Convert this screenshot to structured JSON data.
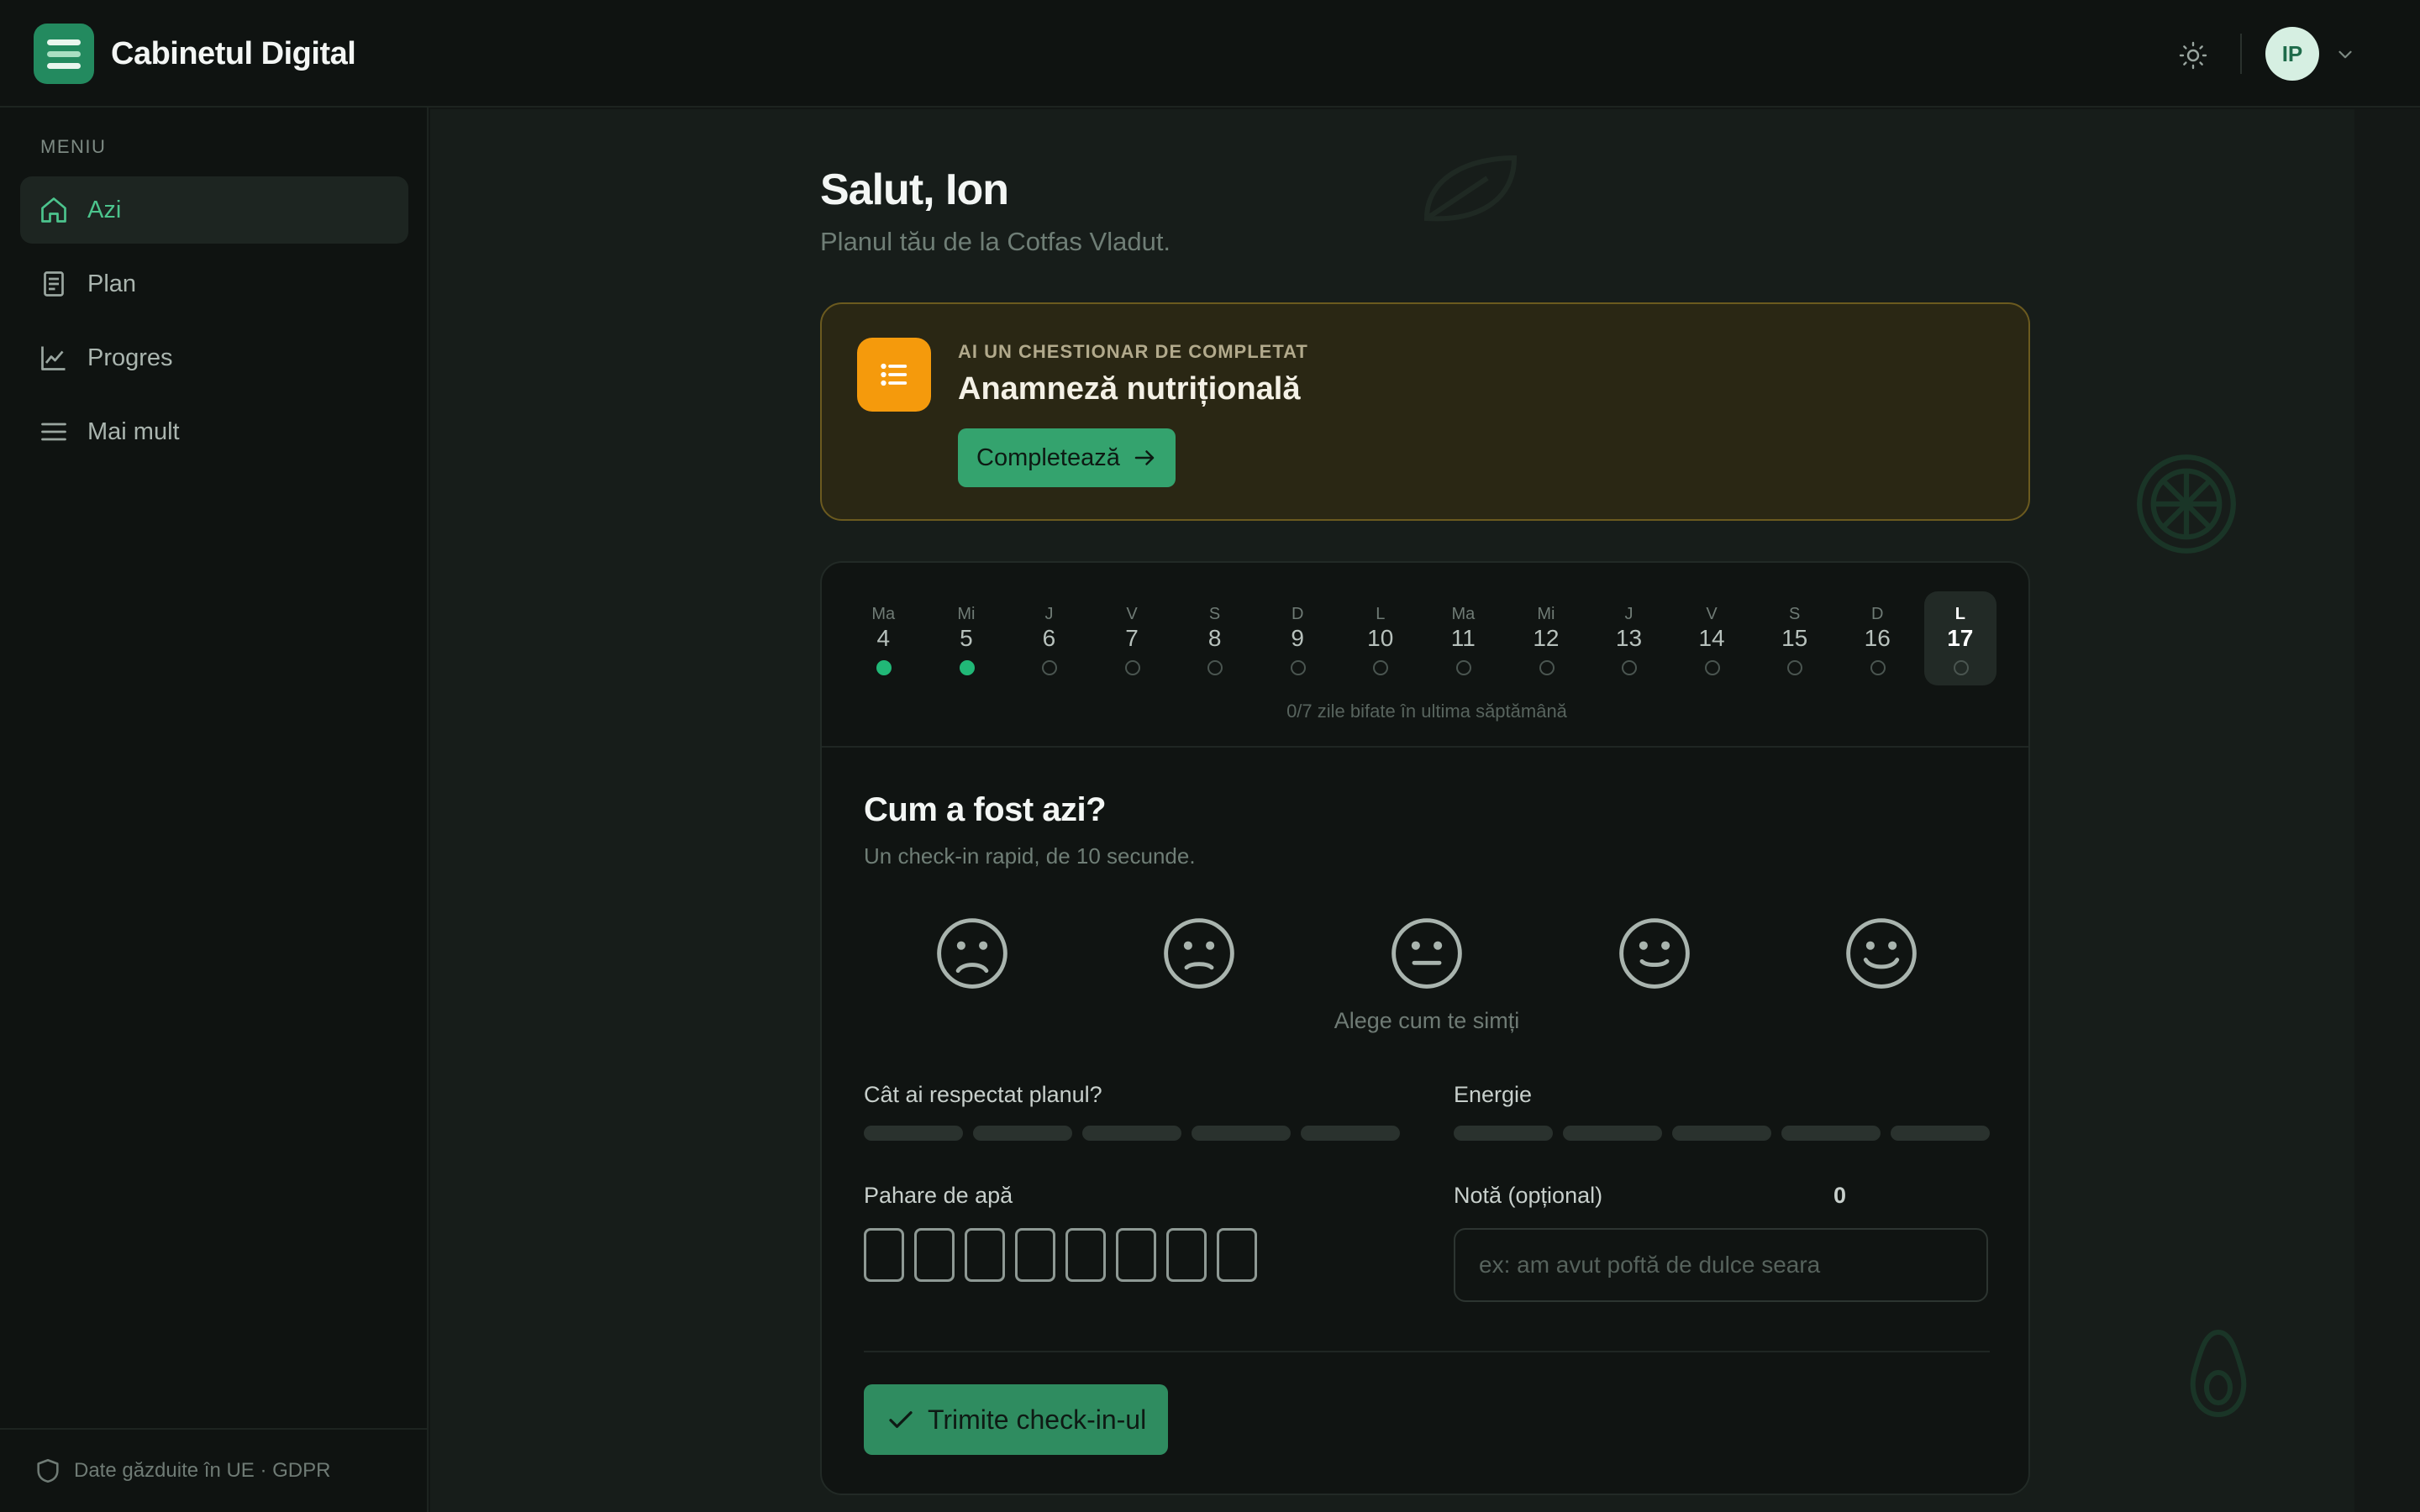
{
  "app": {
    "name": "Cabinetul Digital"
  },
  "header": {
    "avatar_initials": "IP"
  },
  "sidebar": {
    "heading": "MENIU",
    "items": [
      {
        "label": "Azi",
        "icon": "home-icon",
        "active": true
      },
      {
        "label": "Plan",
        "icon": "document-icon",
        "active": false
      },
      {
        "label": "Progres",
        "icon": "chart-icon",
        "active": false
      },
      {
        "label": "Mai mult",
        "icon": "menu-icon",
        "active": false
      }
    ],
    "footer": "Date găzduite în UE · GDPR"
  },
  "main": {
    "greeting": "Salut, Ion",
    "subtitle": "Planul tău de la Cotfas Vladut.",
    "questionnaire": {
      "kicker": "AI UN CHESTIONAR DE COMPLETAT",
      "title": "Anamneză nutrițională",
      "button": "Completează"
    },
    "week": {
      "days": [
        {
          "letter": "Ma",
          "num": "4",
          "done": true
        },
        {
          "letter": "Mi",
          "num": "5",
          "done": true
        },
        {
          "letter": "J",
          "num": "6",
          "done": false
        },
        {
          "letter": "V",
          "num": "7",
          "done": false
        },
        {
          "letter": "S",
          "num": "8",
          "done": false
        },
        {
          "letter": "D",
          "num": "9",
          "done": false
        },
        {
          "letter": "L",
          "num": "10",
          "done": false
        },
        {
          "letter": "Ma",
          "num": "11",
          "done": false
        },
        {
          "letter": "Mi",
          "num": "12",
          "done": false
        },
        {
          "letter": "J",
          "num": "13",
          "done": false
        },
        {
          "letter": "V",
          "num": "14",
          "done": false
        },
        {
          "letter": "S",
          "num": "15",
          "done": false
        },
        {
          "letter": "D",
          "num": "16",
          "done": false
        },
        {
          "letter": "L",
          "num": "17",
          "done": false,
          "current": true
        }
      ],
      "summary": "0/7 zile bifate în ultima săptămână"
    },
    "checkin": {
      "title": "Cum a fost azi?",
      "subtitle": "Un check-in rapid, de 10 secunde.",
      "mood_hint": "Alege cum te simți",
      "adherence_label": "Cât ai respectat planul?",
      "energy_label": "Energie",
      "water_label": "Pahare de apă",
      "water_count": "0",
      "water_glasses": 8,
      "note_label": "Notă (opțional)",
      "note_placeholder": "ex: am avut poftă de dulce seara",
      "submit": "Trimite check-in-ul"
    }
  },
  "colors": {
    "accent": "#34a36e",
    "accent_text": "#4cc48d",
    "warning": "#f59a0c",
    "dot_done": "#21b877"
  }
}
